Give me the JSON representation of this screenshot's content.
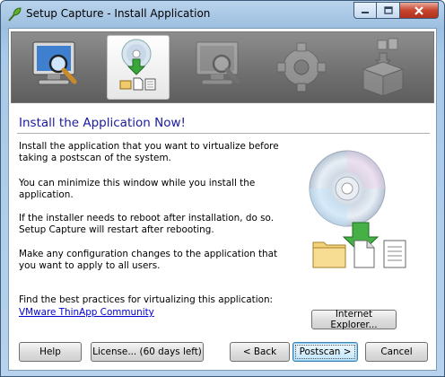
{
  "window": {
    "title": "Setup Capture - Install Application"
  },
  "banner": {
    "steps": [
      {
        "name": "prescan",
        "active": false
      },
      {
        "name": "install",
        "active": true
      },
      {
        "name": "postscan",
        "active": false
      },
      {
        "name": "configure",
        "active": false
      },
      {
        "name": "build",
        "active": false
      }
    ]
  },
  "content": {
    "heading": "Install the Application Now!",
    "paragraphs": [
      "Install the application that you want to virtualize before taking a postscan of the system.",
      "You can minimize this window while you install the application.",
      "If the installer needs to reboot after installation, do so. Setup Capture will restart after rebooting.",
      "Make any configuration changes to the application that you want to apply to all users."
    ],
    "best_practices_text": "Find the best practices for virtualizing this application:",
    "link_label": "VMware ThinApp Community",
    "browser_button": "Internet Explorer..."
  },
  "footer": {
    "help": "Help",
    "license": "License... (60 days left)",
    "back": "< Back",
    "postscan": "Postscan >",
    "cancel": "Cancel"
  }
}
